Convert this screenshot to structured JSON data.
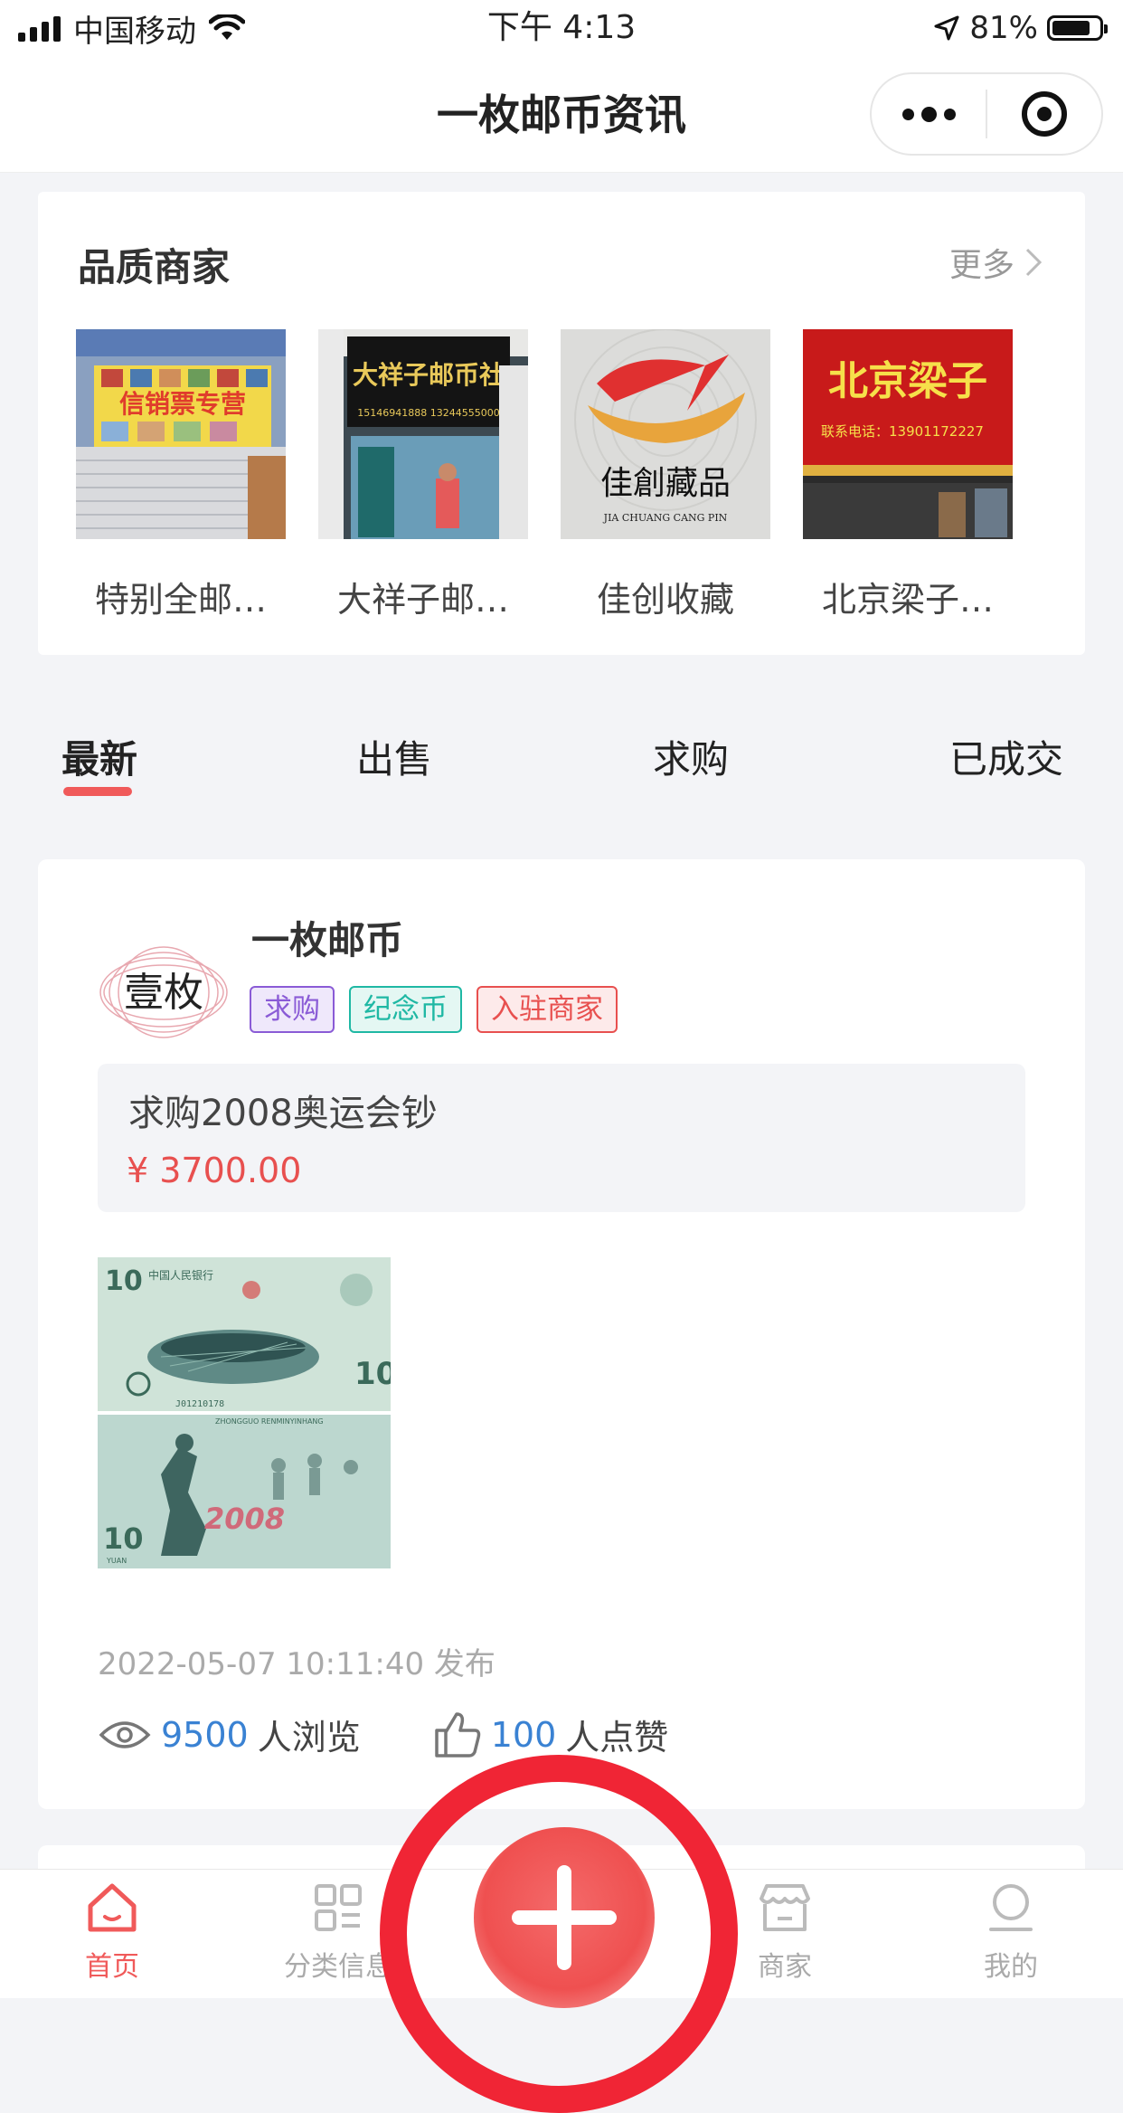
{
  "status_bar": {
    "carrier": "中国移动",
    "time": "下午 4:13",
    "battery_percent": "81%",
    "battery_level": 0.81
  },
  "nav": {
    "title": "一枚邮币资讯"
  },
  "merchants": {
    "title": "品质商家",
    "more": "更多",
    "items": [
      {
        "name": "特别全邮…",
        "sign": "信销票专营"
      },
      {
        "name": "大祥子邮…",
        "sign": "大祥子邮币社"
      },
      {
        "name": "佳创收藏",
        "sign": "佳創藏品",
        "sign_en": "JIA CHUANG CANG PIN"
      },
      {
        "name": "北京梁子…",
        "sign": "北京梁子",
        "phone": "联系电话：13901172227"
      }
    ]
  },
  "tabs": [
    {
      "label": "最新",
      "active": true
    },
    {
      "label": "出售",
      "active": false
    },
    {
      "label": "求购",
      "active": false
    },
    {
      "label": "已成交",
      "active": false
    }
  ],
  "post": {
    "avatar_text": "壹枚",
    "user": "一枚邮币",
    "tags": [
      {
        "label": "求购",
        "color": "#8a5bd6",
        "bg": "#efe8fb"
      },
      {
        "label": "纪念币",
        "color": "#1fb8a4",
        "bg": "#e4f7f3"
      },
      {
        "label": "入驻商家",
        "color": "#e8504f",
        "bg": "#fdeaea"
      }
    ],
    "content": "求购2008奥运会钞",
    "price": "¥ 3700.00",
    "timestamp": "2022-05-07 10:11:40 发布",
    "views_count": "9500",
    "views_suffix": "人浏览",
    "likes_count": "100",
    "likes_suffix": "人点赞"
  },
  "tabbar": [
    {
      "label": "首页",
      "icon": "home-icon",
      "active": true
    },
    {
      "label": "分类信息",
      "icon": "category-icon",
      "active": false
    },
    {
      "label": "商家",
      "icon": "store-icon",
      "active": false
    },
    {
      "label": "我的",
      "icon": "user-icon",
      "active": false
    }
  ],
  "colors": {
    "accent": "#f05a5a",
    "price": "#e8504f",
    "link_number": "#3a82d3"
  }
}
